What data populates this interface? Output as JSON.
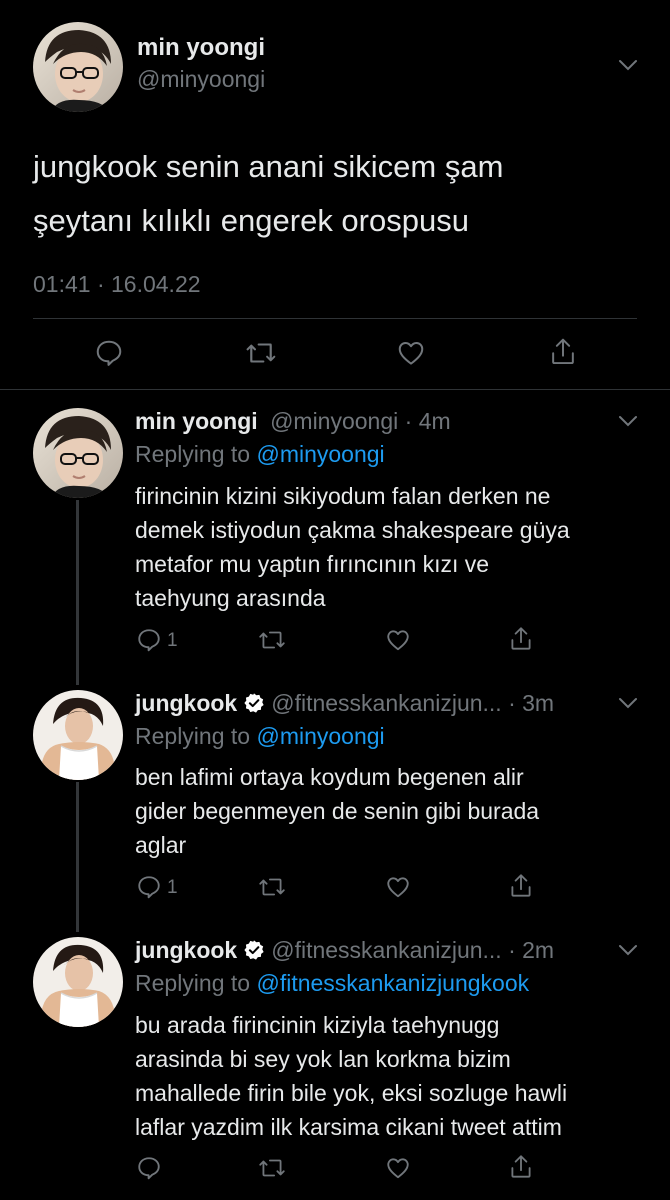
{
  "main_tweet": {
    "display_name": "min yoongi",
    "handle": "@minyoongi",
    "text_line1": "jungkook senin anani sikicem şam",
    "text_line2": "şeytanı kılıklı engerek orospusu",
    "timestamp": "01:41 · 16.04.22"
  },
  "replies": [
    {
      "display_name": "min yoongi",
      "handle": "@minyoongi",
      "time": "· 4m",
      "replying_prefix": "Replying to",
      "replying_to": "@minyoongi",
      "lines": [
        "firincinin kizini sikiyodum falan derken ne",
        "demek istiyodun çakma shakespeare güya",
        "metafor mu yaptın fırıncının kızı ve",
        "taehyung arasında"
      ],
      "reply_count": "1"
    },
    {
      "display_name": "jungkook",
      "handle": "@fitnesskankanizjun...",
      "time": "· 3m",
      "replying_prefix": "Replying to",
      "replying_to": "@minyoongi",
      "lines": [
        "ben lafimi ortaya koydum begenen alir",
        "gider begenmeyen de senin gibi burada",
        "aglar"
      ],
      "reply_count": "1"
    },
    {
      "display_name": "jungkook",
      "handle": "@fitnesskankanizjun...",
      "time": "· 2m",
      "replying_prefix": "Replying to",
      "replying_to": "@fitnesskankanizjungkook",
      "lines": [
        "bu arada firincinin kiziyla taehynugg",
        "arasinda bi sey yok lan korkma bizim",
        "mahallede firin bile yok, eksi sozluge hawli",
        "laflar yazdim ilk karsima cikani tweet attim"
      ],
      "reply_count": ""
    }
  ],
  "colors": {
    "background": "#000000",
    "text": "#e7e9ea",
    "secondary": "#71767b",
    "link": "#1d9bf0",
    "verified": "#ffffff"
  },
  "icons": [
    "chevron-down-icon",
    "reply-icon",
    "retweet-icon",
    "like-icon",
    "share-icon",
    "verified-icon"
  ]
}
